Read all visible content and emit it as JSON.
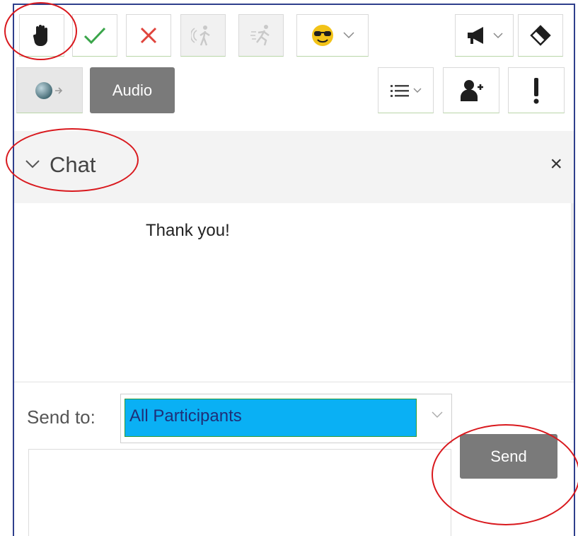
{
  "toolbar": {
    "row1": [
      {
        "name": "raise-hand",
        "icon": "hand-icon"
      },
      {
        "name": "yes",
        "icon": "checkmark-icon"
      },
      {
        "name": "no",
        "icon": "cross-icon"
      },
      {
        "name": "go-slower",
        "icon": "walk-icon",
        "disabled": true
      },
      {
        "name": "go-faster",
        "icon": "run-icon",
        "disabled": true
      },
      {
        "name": "emoticon",
        "icon": "sunglasses-emoji-icon"
      },
      {
        "name": "announce",
        "icon": "megaphone-icon"
      },
      {
        "name": "clear-status",
        "icon": "eraser-icon"
      }
    ],
    "row2": [
      {
        "name": "audio-connect",
        "icon": "audio-connect-icon"
      },
      {
        "name": "list-menu",
        "icon": "list-icon"
      },
      {
        "name": "add-participant",
        "icon": "add-user-icon"
      },
      {
        "name": "alert",
        "icon": "exclamation-icon"
      }
    ],
    "audio_label": "Audio"
  },
  "chat": {
    "title": "Chat",
    "close_symbol": "×",
    "messages": [
      "Thank you!"
    ],
    "send_to_label": "Send to:",
    "send_to_value": "All Participants",
    "input_value": "",
    "send_label": "Send"
  },
  "colors": {
    "frame_border": "#2f3f8c",
    "button_gray": "#7a7a7a",
    "select_highlight": "#0ab0f4",
    "check_green": "#3aa54a",
    "cross_red": "#e0443c",
    "annotation_red": "#d9191e"
  }
}
